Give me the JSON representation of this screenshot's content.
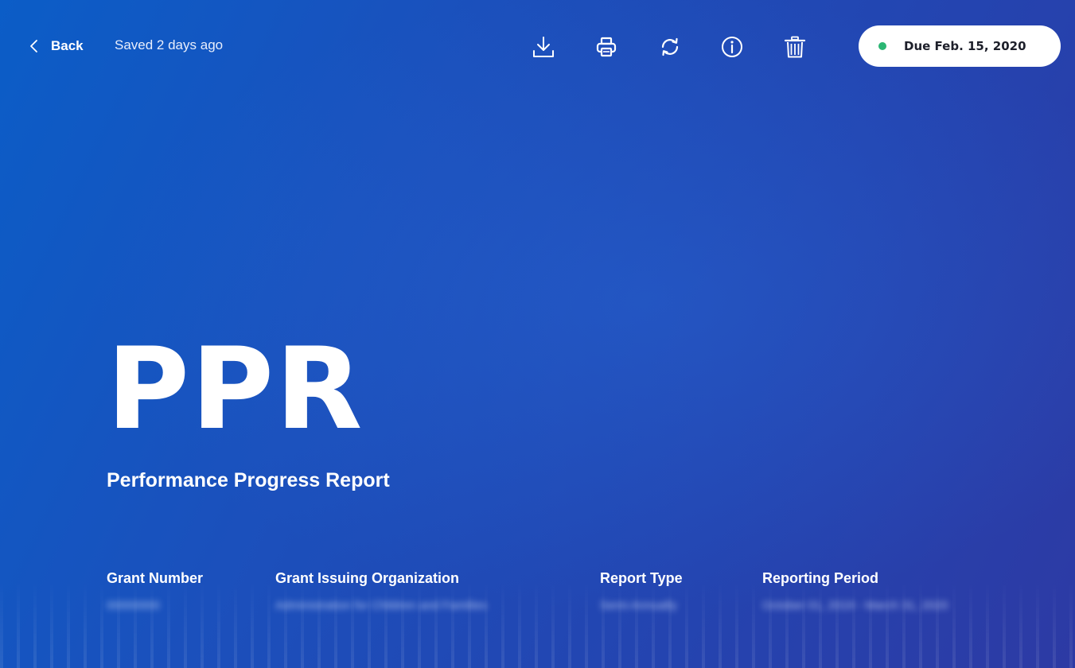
{
  "header": {
    "back_label": "Back",
    "saved_status": "Saved 2 days ago",
    "toolbar_icons": [
      "download-icon",
      "print-icon",
      "refresh-icon",
      "info-icon",
      "trash-icon"
    ],
    "due_badge": {
      "text": "Due Feb. 15, 2020",
      "dot_color": "#2bb673"
    }
  },
  "hero": {
    "title": "PPR",
    "subtitle": "Performance Progress Report"
  },
  "meta": [
    {
      "label": "Grant Number",
      "value": "00000000"
    },
    {
      "label": "Grant Issuing Organization",
      "value": "Administration for Children and Families"
    },
    {
      "label": "Report Type",
      "value": "Semi-Annually"
    },
    {
      "label": "Reporting Period",
      "value": "October 01, 2019 - March 31, 2020"
    }
  ],
  "theme": {
    "background_start": "#0b5dc7",
    "background_end": "#2d3aa4",
    "text": "#ffffff"
  }
}
